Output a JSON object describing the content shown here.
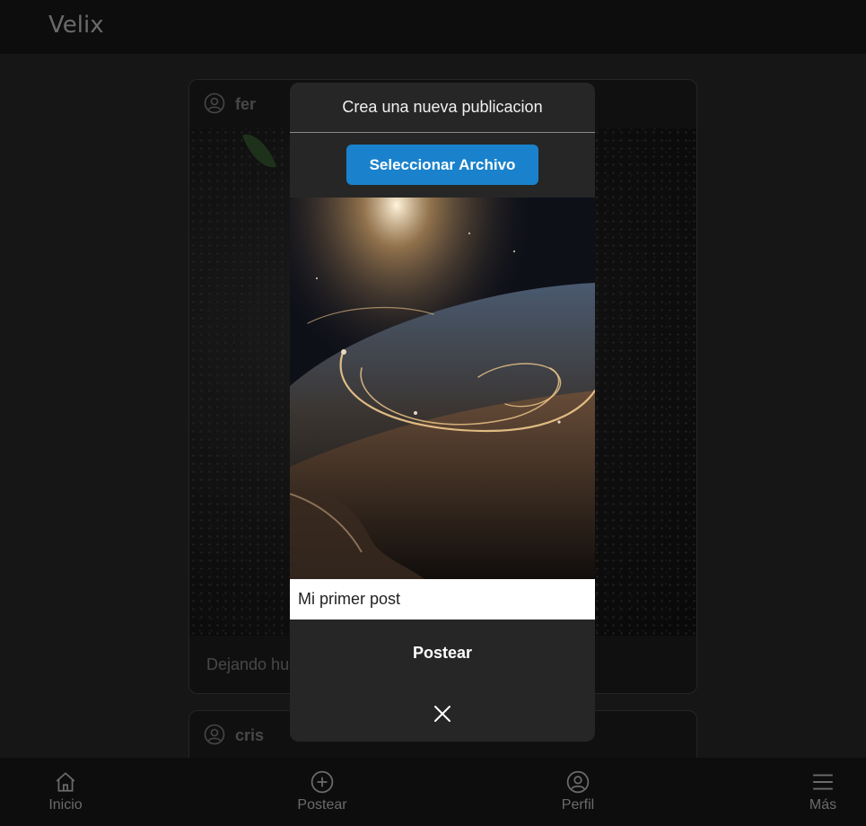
{
  "app": {
    "logo": "Velix"
  },
  "feed": {
    "posts": [
      {
        "user": "fer",
        "caption": "Dejando hue"
      },
      {
        "user": "cris"
      }
    ]
  },
  "modal": {
    "title": "Crea una nueva publicacion",
    "select_label": "Seleccionar Archivo",
    "caption_value": "Mi primer post",
    "post_label": "Postear",
    "close_icon": "close-icon"
  },
  "bottom_nav": {
    "items": [
      {
        "label": "Inicio",
        "icon": "home-icon"
      },
      {
        "label": "Postear",
        "icon": "plus-circle-icon"
      },
      {
        "label": "Perfil",
        "icon": "user-circle-icon"
      },
      {
        "label": "Más",
        "icon": "menu-icon"
      }
    ]
  },
  "colors": {
    "accent": "#1a82cc",
    "background": "#222222",
    "bar": "#0d0d0d"
  }
}
